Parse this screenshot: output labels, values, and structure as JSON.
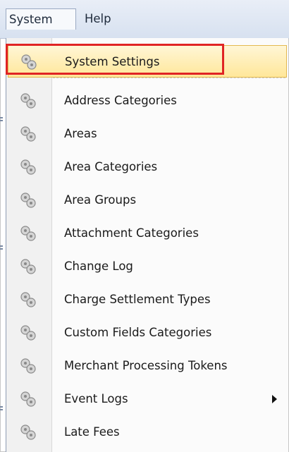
{
  "menubar": {
    "items": [
      {
        "label": "System",
        "open": true
      },
      {
        "label": "Help",
        "open": false
      }
    ]
  },
  "menu": {
    "items": [
      {
        "label": "System Settings",
        "icon": "gears-icon",
        "highlighted": true,
        "submenu": false
      },
      {
        "label": "Address Categories",
        "icon": "gears-icon",
        "submenu": false
      },
      {
        "label": "Areas",
        "icon": "gears-icon",
        "submenu": false
      },
      {
        "label": "Area Categories",
        "icon": "gears-icon",
        "submenu": false
      },
      {
        "label": "Area Groups",
        "icon": "gears-icon",
        "submenu": false
      },
      {
        "label": "Attachment Categories",
        "icon": "gears-icon",
        "submenu": false
      },
      {
        "label": "Change Log",
        "icon": "gears-icon",
        "submenu": false
      },
      {
        "label": "Charge Settlement Types",
        "icon": "gears-icon",
        "submenu": false
      },
      {
        "label": "Custom Fields Categories",
        "icon": "gears-icon",
        "submenu": false
      },
      {
        "label": "Merchant Processing Tokens",
        "icon": "gears-icon",
        "submenu": false
      },
      {
        "label": "Event Logs",
        "icon": "gears-icon",
        "submenu": true
      },
      {
        "label": "Late Fees",
        "icon": "gears-icon",
        "submenu": false
      }
    ]
  },
  "colors": {
    "highlight_fill": "#ffe79a",
    "annotation_border": "#e02424"
  }
}
